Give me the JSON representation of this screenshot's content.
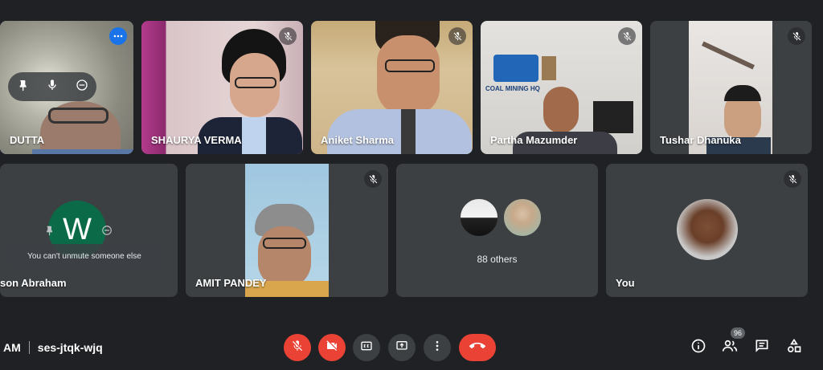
{
  "participants_top": [
    {
      "name": "DUTTA"
    },
    {
      "name": "SHAURYA VERMA"
    },
    {
      "name": "Aniket Sharma"
    },
    {
      "name": "Partha Mazumder"
    },
    {
      "name": "Tushar Dhanuka"
    }
  ],
  "participants_bottom": [
    {
      "name": "son Abraham",
      "initial": "W",
      "tooltip": "You can't unmute someone else"
    },
    {
      "name": "AMIT PANDEY"
    },
    {
      "others": "88 others"
    },
    {
      "name": "You"
    }
  ],
  "meeting": {
    "time_suffix": "AM",
    "code": "ses-jtqk-wjq"
  },
  "people_count": "96",
  "wall_sign": "COAL MINING HQ",
  "icons": {
    "mute": "mic-off-icon",
    "pin": "pin-icon",
    "mic": "mic-icon",
    "remove": "remove-icon",
    "more": "more-vert-icon",
    "cam": "videocam-off-icon",
    "cc": "closed-caption-icon",
    "present": "present-screen-icon",
    "end": "call-end-icon",
    "info": "info-icon",
    "people": "people-icon",
    "chat": "chat-icon",
    "activities": "activities-icon"
  },
  "colors": {
    "background": "#202124",
    "tile": "#3c4043",
    "red": "#ea4335",
    "active_outline": "#8ab4f8",
    "avatar_green": "#0b6b48"
  }
}
